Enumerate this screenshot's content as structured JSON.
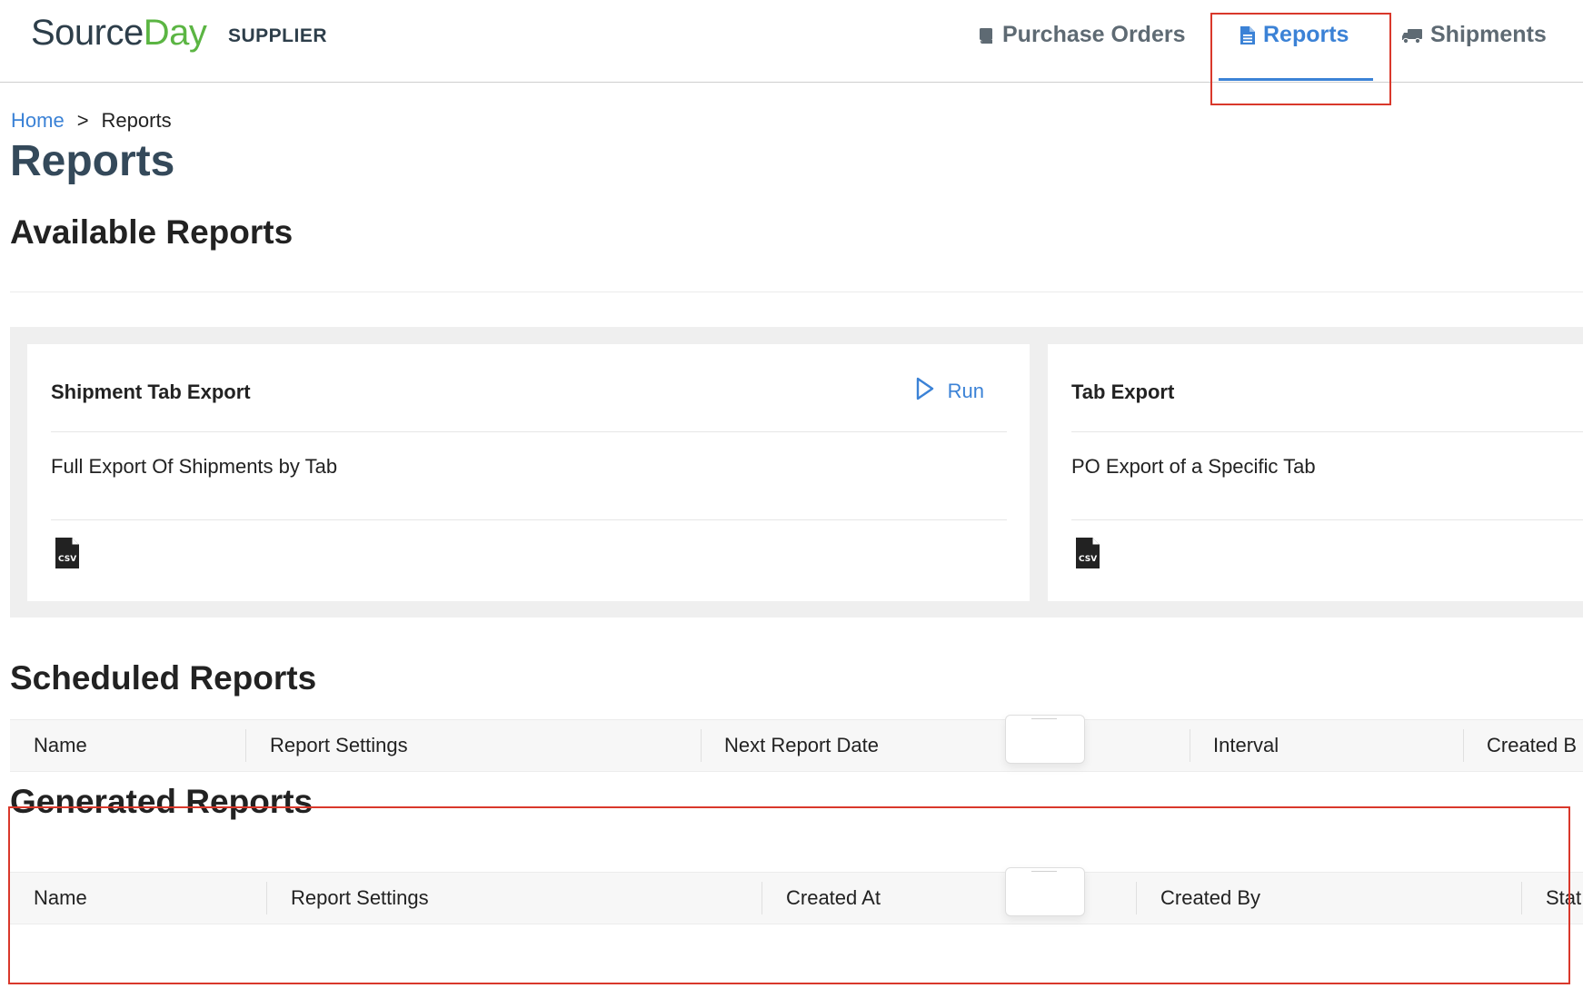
{
  "header": {
    "logo_part1": "Source",
    "logo_part2": "Day",
    "badge": "SUPPLIER",
    "nav": {
      "purchase_orders": "Purchase Orders",
      "reports": "Reports",
      "shipments": "Shipments"
    },
    "active_tab": "Reports"
  },
  "breadcrumb": {
    "home": "Home",
    "separator": ">",
    "current": "Reports"
  },
  "page_title": "Reports",
  "available_reports": {
    "heading": "Available Reports",
    "cards": [
      {
        "title": "Shipment Tab Export",
        "description": "Full Export Of Shipments by Tab",
        "run_label": "Run",
        "file_type": "CSV"
      },
      {
        "title": "Tab Export",
        "description": "PO Export of a Specific Tab",
        "file_type": "CSV"
      }
    ]
  },
  "scheduled_reports": {
    "heading": "Scheduled Reports",
    "columns": [
      "Name",
      "Report Settings",
      "Next Report Date",
      "Interval",
      "Created B"
    ]
  },
  "generated_reports": {
    "heading": "Generated Reports",
    "columns": [
      "Name",
      "Report Settings",
      "Created At",
      "Created By",
      "Stat"
    ]
  },
  "colors": {
    "accent": "#3b82d6",
    "brand_dark": "#2d3e4a",
    "brand_green": "#5bb543",
    "highlight": "#d9382b"
  },
  "icons": {
    "purchase_orders": "book-icon",
    "reports": "file-text-icon",
    "shipments": "truck-icon",
    "run": "play-outline-icon",
    "file": "csv-file-icon"
  }
}
